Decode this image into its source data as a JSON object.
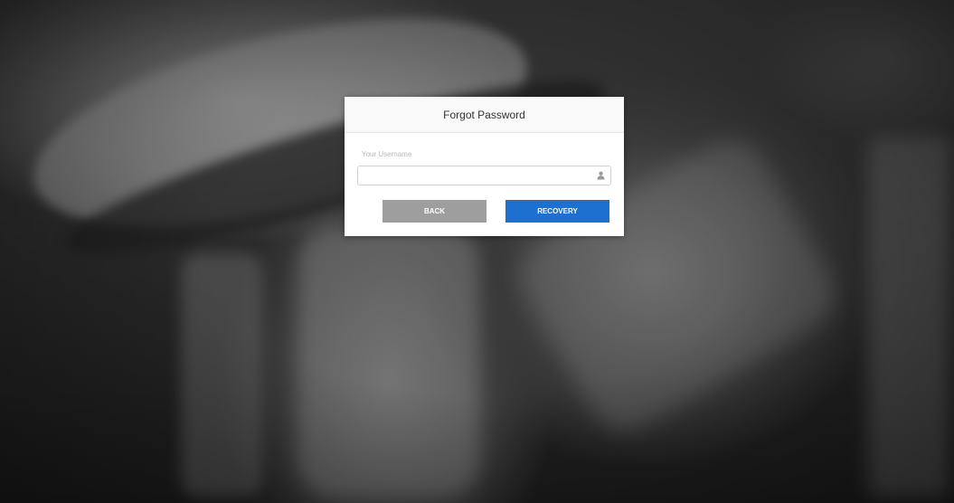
{
  "dialog": {
    "title": "Forgot Password",
    "username_label": "Your Username",
    "username_value": "",
    "username_icon": "user-icon",
    "back_label": "BACK",
    "recovery_label": "RECOVERY"
  },
  "colors": {
    "recovery_button": "#1d6fd0",
    "back_button": "#9e9e9e"
  }
}
